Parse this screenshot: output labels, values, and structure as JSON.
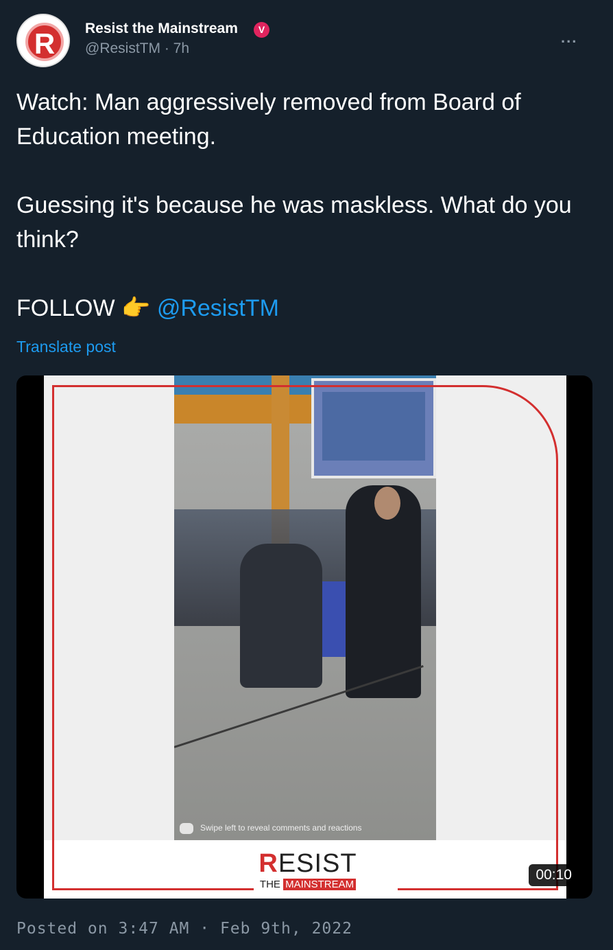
{
  "account": {
    "display_name": "Resist the Mainstream",
    "verified_badge": "V",
    "handle": "@ResistTM",
    "separator": "·",
    "time_ago": "7h",
    "avatar_letter": "R"
  },
  "more_menu": "...",
  "tweet": {
    "line1": "Watch: Man aggressively removed from Board of Education meeting.",
    "line2": "Guessing it's because he was maskless. What do you think?",
    "follow_label": "FOLLOW",
    "follow_emoji": "👉",
    "mention": "@ResistTM"
  },
  "translate_label": "Translate post",
  "media": {
    "swipe_caption": "Swipe left to reveal comments and reactions",
    "brand_r": "R",
    "brand_rest": "ESIST",
    "brand_the": "THE",
    "brand_mainstream": "MAINSTREAM",
    "duration": "00:10"
  },
  "posted_on": "Posted on 3:47 AM · Feb 9th, 2022",
  "colors": {
    "background": "#15202b",
    "link": "#1d9bf0",
    "brand_red": "#d32f2f",
    "muted": "#8b98a5"
  },
  "icons": {
    "verified": "verified-badge-icon",
    "more": "more-dots-icon",
    "play": "video-icon"
  }
}
